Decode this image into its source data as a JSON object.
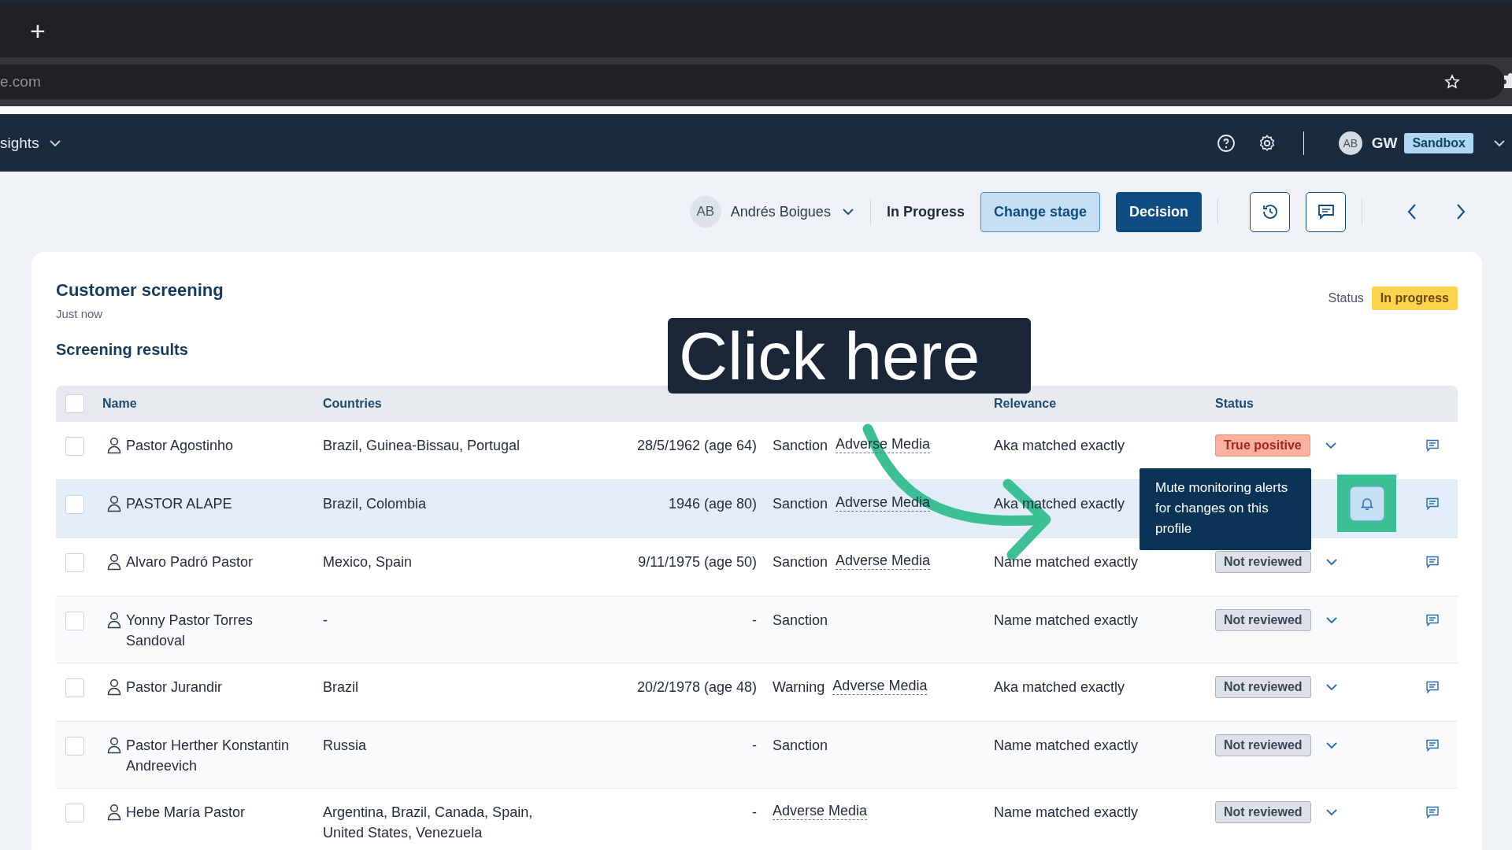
{
  "browser": {
    "new_tab": "+",
    "address": "e.com"
  },
  "app_nav": {
    "section": "sights",
    "user_initials": "AB",
    "user": "GW",
    "environment": "Sandbox"
  },
  "toolbar": {
    "assignee_initials": "AB",
    "assignee": "Andrés Boigues",
    "stage": "In Progress",
    "buttons": [
      {
        "label": "Change stage",
        "kind": "secondary"
      },
      {
        "label": "Decision",
        "kind": "primary"
      }
    ]
  },
  "card": {
    "title": "Customer screening",
    "time": "Just now",
    "status_label": "Status",
    "status": "In progress",
    "section": "Screening results"
  },
  "table": {
    "select_all": {
      "checked": false
    },
    "columns": [
      "Name",
      "Countries",
      "Relevance",
      "Status"
    ],
    "rows": [
      {
        "checked": false,
        "highlighted": false,
        "name": "Pastor Agostinho",
        "countries": "Brazil, Guinea-Bissau, Portugal",
        "dob": "28/5/1962 (age 64)",
        "risks": [
          {
            "label": "Sanction",
            "kind": "plain"
          },
          {
            "label": "Adverse Media",
            "kind": "link"
          }
        ],
        "relevance": "Aka matched exactly",
        "status": {
          "label": "True positive",
          "kind": "true_positive"
        }
      },
      {
        "checked": false,
        "highlighted": true,
        "name": "PASTOR ALAPE",
        "countries": "Brazil, Colombia",
        "dob": "1946 (age 80)",
        "risks": [
          {
            "label": "Sanction",
            "kind": "plain"
          },
          {
            "label": "Adverse Media",
            "kind": "link"
          }
        ],
        "relevance": "Aka matched exactly",
        "tooltip": "Mute monitoring alerts for changes on this profile"
      },
      {
        "checked": false,
        "highlighted": false,
        "name": "Alvaro Padró Pastor",
        "countries": "Mexico, Spain",
        "dob": "9/11/1975 (age 50)",
        "risks": [
          {
            "label": "Sanction",
            "kind": "plain"
          },
          {
            "label": "Adverse Media",
            "kind": "link"
          }
        ],
        "relevance": "Name matched exactly",
        "status": {
          "label": "Not reviewed",
          "kind": "not_reviewed"
        }
      },
      {
        "checked": false,
        "highlighted": false,
        "name": "Yonny Pastor Torres Sandoval",
        "countries": "-",
        "dob": "-",
        "risks": [
          {
            "label": "Sanction",
            "kind": "plain"
          }
        ],
        "relevance": "Name matched exactly",
        "status": {
          "label": "Not reviewed",
          "kind": "not_reviewed"
        }
      },
      {
        "checked": false,
        "highlighted": false,
        "name": "Pastor Jurandir",
        "countries": "Brazil",
        "dob": "20/2/1978 (age 48)",
        "risks": [
          {
            "label": "Warning",
            "kind": "plain"
          },
          {
            "label": "Adverse Media",
            "kind": "link"
          }
        ],
        "relevance": "Aka matched exactly",
        "status": {
          "label": "Not reviewed",
          "kind": "not_reviewed"
        }
      },
      {
        "checked": false,
        "highlighted": false,
        "name": "Pastor Herther Konstantin Andreevich",
        "countries": "Russia",
        "dob": "-",
        "risks": [
          {
            "label": "Sanction",
            "kind": "plain"
          }
        ],
        "relevance": "Name matched exactly",
        "status": {
          "label": "Not reviewed",
          "kind": "not_reviewed"
        }
      },
      {
        "checked": false,
        "highlighted": false,
        "name": "Hebe María Pastor",
        "countries": "Argentina, Brazil, Canada, Spain, United States, Venezuela",
        "dob": "-",
        "risks": [
          {
            "label": "Adverse Media",
            "kind": "link"
          }
        ],
        "relevance": "Name matched exactly",
        "status": {
          "label": "Not reviewed",
          "kind": "not_reviewed"
        }
      }
    ]
  },
  "annotation": {
    "text": "Click here"
  }
}
